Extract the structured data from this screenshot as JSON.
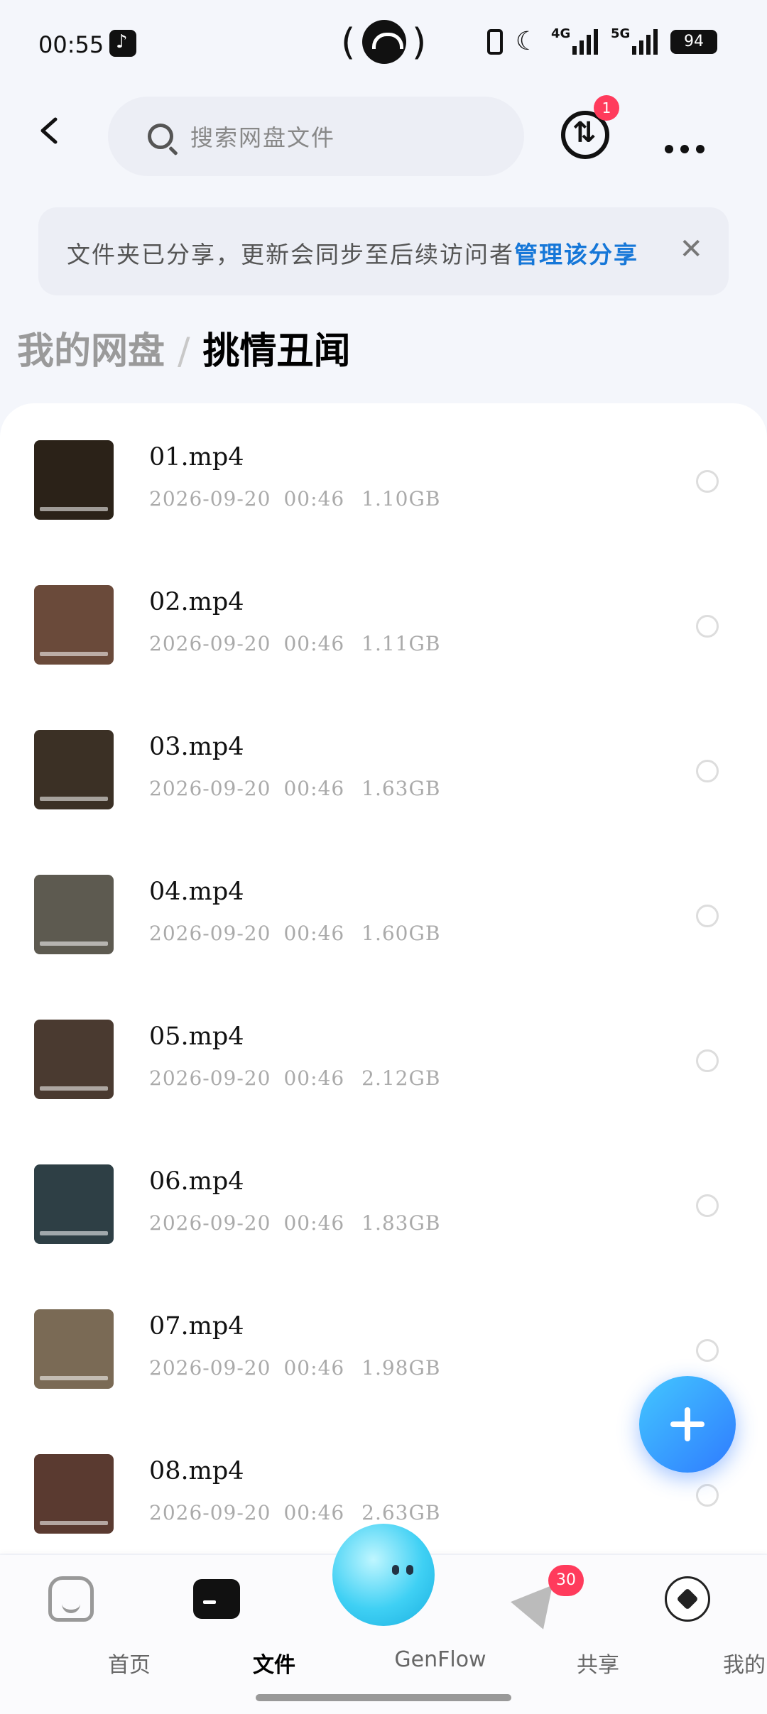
{
  "status_bar": {
    "time": "00:55",
    "network_4g": "4G",
    "network_5g": "5G",
    "battery": "94"
  },
  "header": {
    "search_placeholder": "搜索网盘文件",
    "transfer_badge": "1"
  },
  "notice": {
    "text": "文件夹已分享，更新会同步至后续访问者",
    "link": "管理该分享",
    "close_icon": "close-icon"
  },
  "breadcrumb": {
    "root": "我的网盘",
    "separator": "/",
    "current": "挑情丑闻"
  },
  "files": [
    {
      "name": "01.mp4",
      "date": "2026-09-20",
      "time": "00:46",
      "size": "1.10GB"
    },
    {
      "name": "02.mp4",
      "date": "2026-09-20",
      "time": "00:46",
      "size": "1.11GB"
    },
    {
      "name": "03.mp4",
      "date": "2026-09-20",
      "time": "00:46",
      "size": "1.63GB"
    },
    {
      "name": "04.mp4",
      "date": "2026-09-20",
      "time": "00:46",
      "size": "1.60GB"
    },
    {
      "name": "05.mp4",
      "date": "2026-09-20",
      "time": "00:46",
      "size": "2.12GB"
    },
    {
      "name": "06.mp4",
      "date": "2026-09-20",
      "time": "00:46",
      "size": "1.83GB"
    },
    {
      "name": "07.mp4",
      "date": "2026-09-20",
      "time": "00:46",
      "size": "1.98GB"
    },
    {
      "name": "08.mp4",
      "date": "2026-09-20",
      "time": "00:46",
      "size": "2.63GB"
    }
  ],
  "tabbar": {
    "home": "首页",
    "files": "文件",
    "genflow": "GenFlow",
    "share": "共享",
    "share_badge": "30",
    "me": "我的"
  },
  "colors": {
    "accent_link": "#1677d8",
    "badge_red": "#ff3b5c",
    "fab_blue": "#2f7bff"
  }
}
